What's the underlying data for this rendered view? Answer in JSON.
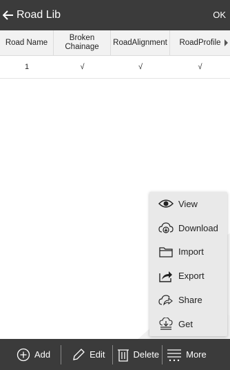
{
  "topbar": {
    "title": "Road Lib",
    "ok_label": "OK"
  },
  "table": {
    "columns": [
      "Road Name",
      "Broken Chainage",
      "RoadAlignment",
      "RoadProfile"
    ],
    "rows": [
      [
        "1",
        "√",
        "√",
        "√"
      ]
    ]
  },
  "menu": {
    "items": [
      {
        "label": "View",
        "icon": "eye-icon"
      },
      {
        "label": "Download",
        "icon": "cloud-download-icon"
      },
      {
        "label": "Import",
        "icon": "folder-icon"
      },
      {
        "label": "Export",
        "icon": "export-arrow-icon"
      },
      {
        "label": "Share",
        "icon": "cloud-share-icon"
      },
      {
        "label": "Get",
        "icon": "get-download-icon"
      }
    ]
  },
  "bottombar": {
    "add": "Add",
    "edit": "Edit",
    "delete": "Delete",
    "more": "More"
  },
  "colors": {
    "bar": "#3b3b3b",
    "header_bg": "#f2f2f2",
    "menu_bg": "#e9e9e9"
  }
}
